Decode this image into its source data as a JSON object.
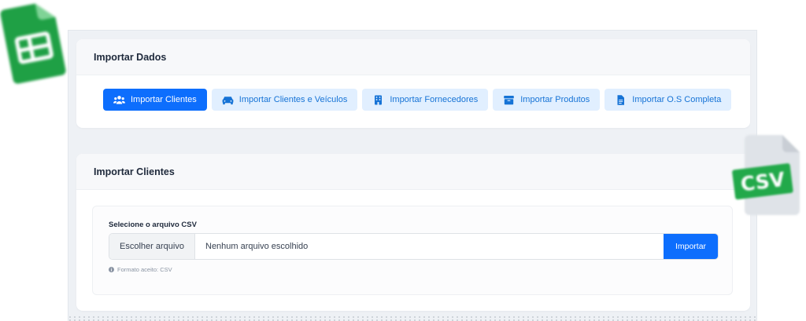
{
  "import_data": {
    "title": "Importar Dados",
    "tabs": [
      {
        "label": "Importar Clientes",
        "icon": "users-icon",
        "active": true
      },
      {
        "label": "Importar Clientes e Veículos",
        "icon": "car-icon",
        "active": false
      },
      {
        "label": "Importar Fornecedores",
        "icon": "building-icon",
        "active": false
      },
      {
        "label": "Importar Produtos",
        "icon": "box-icon",
        "active": false
      },
      {
        "label": "Importar O.S Completa",
        "icon": "file-icon",
        "active": false
      }
    ]
  },
  "import_clients": {
    "title": "Importar Clientes",
    "field_label": "Selecione o arquivo CSV",
    "choose_file_label": "Escolher arquivo",
    "file_name": "Nenhum arquivo escolhido",
    "submit_label": "Importar",
    "hint": "Formato aceito: CSV"
  },
  "badges": {
    "csv_text": "CSV"
  },
  "colors": {
    "primary": "#0d6efd",
    "tab_bg": "#e1efff",
    "sheets_green": "#1fa045",
    "csv_green": "#22a94a"
  }
}
